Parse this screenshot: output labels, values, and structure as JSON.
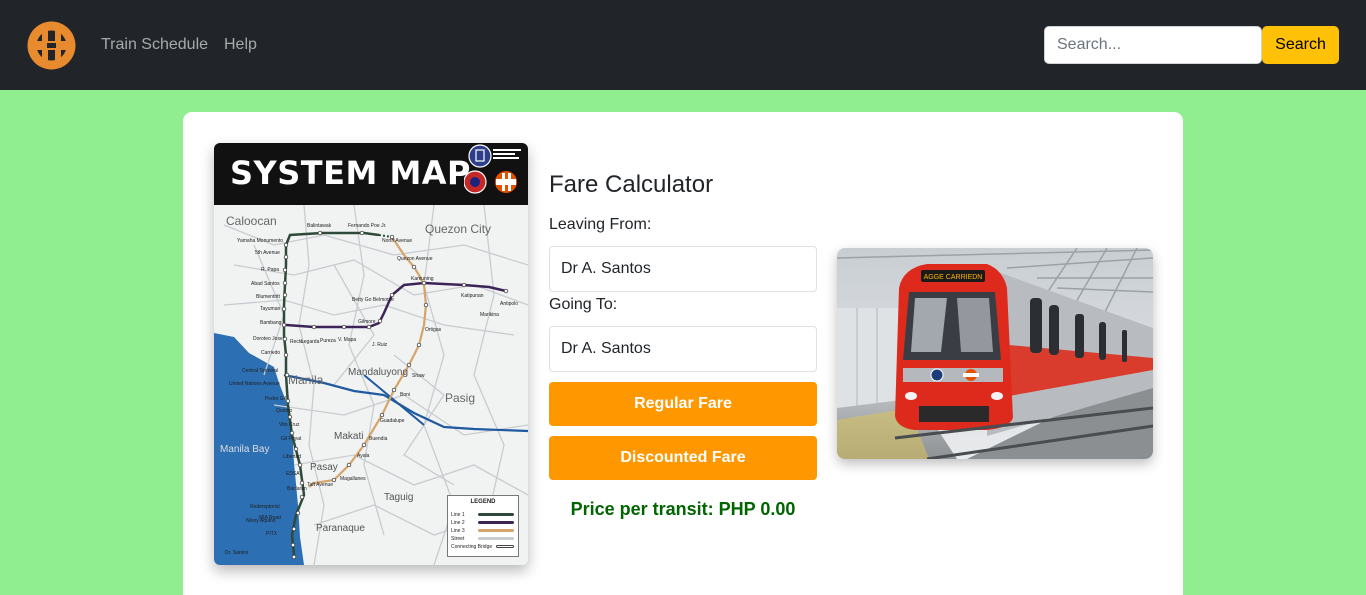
{
  "navbar": {
    "logo_icon": "lrt-logo-icon",
    "links": [
      "Train Schedule",
      "Help"
    ],
    "search_placeholder": "Search...",
    "search_button": "Search",
    "background": "#212529",
    "accent": "#ffc107"
  },
  "system_map": {
    "title": "SYSTEM MAP",
    "areas": [
      "Caloocan",
      "Quezon City",
      "Manila",
      "Mandaluyong",
      "Pasig",
      "Manila Bay",
      "Makati",
      "Pasay",
      "Taguig",
      "Paranaque"
    ],
    "legend": {
      "title": "LEGEND",
      "items": [
        {
          "label": "Line 1",
          "color": "#2e4a3a"
        },
        {
          "label": "Line 2",
          "color": "#3d2458"
        },
        {
          "label": "Line 3",
          "color": "#d4a46a"
        },
        {
          "label": "Street",
          "color": "#c8ccd0"
        },
        {
          "label": "Connecting Bridge",
          "color": "#ffffff"
        }
      ]
    },
    "stations": [
      "Balintawak",
      "Fernando Poe Jr.",
      "North Avenue",
      "Quezon Avenue",
      "Kamuning",
      "Araneta Center Anonas",
      "Katipunan",
      "Santolan",
      "Antipolo",
      "Marikina",
      "Betty Go Belmonte",
      "Gilmore",
      "J. Ruiz",
      "Cubao",
      "Santolan",
      "Ortigas",
      "Shaw",
      "Boni",
      "Guadalupe",
      "Buendia",
      "Ayala",
      "Magallanes",
      "Taft Avenue",
      "Yamaha Monumento",
      "5th Avenue",
      "R. Papa",
      "Abad Santos",
      "Blumentritt",
      "Tayuman",
      "Bambang",
      "Doroteo Jose",
      "Carriedo",
      "Central Terminal",
      "United Nations Avenue",
      "Pedro Gil",
      "Quirino",
      "Vito Cruz",
      "Gil Puyat",
      "Libertad",
      "EDSA",
      "Baclaran",
      "Redemptorist",
      "Ninoy Aquino",
      "PITX",
      "MIA Road",
      "Dr. Santos",
      "Recto",
      "Legarda",
      "Pureza",
      "V. Mapa"
    ]
  },
  "fare_calculator": {
    "title": "Fare Calculator",
    "leaving_label": "Leaving From:",
    "leaving_value": "Dr A. Santos",
    "going_label": "Going To:",
    "going_value": "Dr A. Santos",
    "regular_button": "Regular Fare",
    "discounted_button": "Discounted Fare",
    "price_text": "Price per transit: PHP 0.00",
    "button_color": "#ff9800",
    "price_color": "#006400"
  },
  "train_photo": {
    "destination_sign": "AGGE CARRIEDN"
  },
  "page": {
    "background": "#90ee90"
  }
}
